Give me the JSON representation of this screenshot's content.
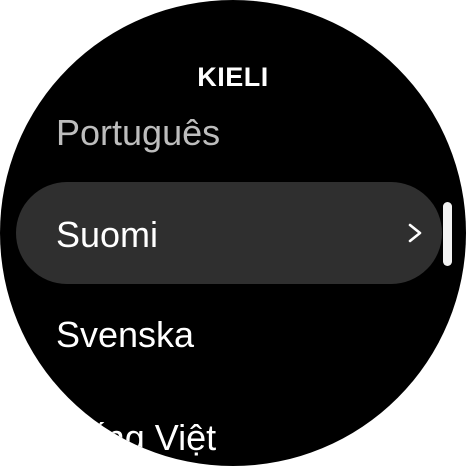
{
  "header": {
    "title": "KIELI"
  },
  "languages": {
    "previous": "Português",
    "selected": "Suomi",
    "next": "Svenska",
    "partial": "Tiếng Việt"
  },
  "icons": {
    "chevron": "chevron-right-icon"
  },
  "colors": {
    "background": "#000000",
    "selected_row": "#2f2f2f",
    "text": "#ffffff",
    "dim_text": "#bdbdbd"
  }
}
